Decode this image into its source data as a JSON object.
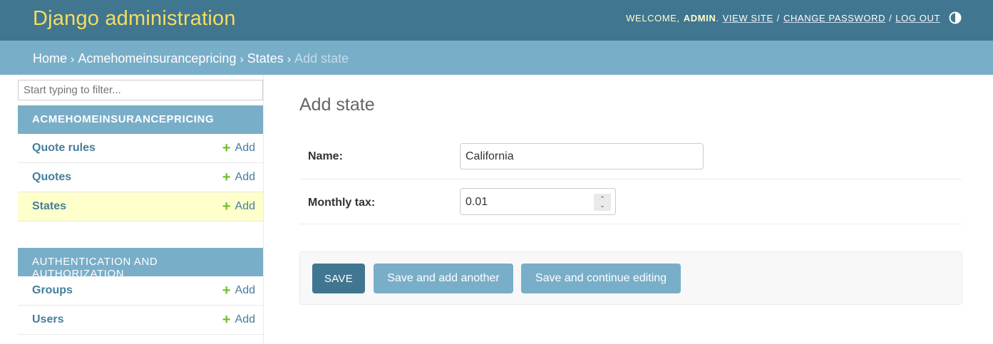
{
  "header": {
    "branding": "Django administration",
    "welcome": "WELCOME,",
    "username": "ADMIN",
    "view_site": "VIEW SITE",
    "change_password": "CHANGE PASSWORD",
    "log_out": "LOG OUT",
    "separator": "/"
  },
  "breadcrumbs": {
    "home": "Home",
    "app": "Acmehomeinsurancepricing",
    "model": "States",
    "current": "Add state",
    "separator": "›"
  },
  "sidebar": {
    "filter_placeholder": "Start typing to filter...",
    "modules": [
      {
        "caption": "ACMEHOMEINSURANCEPRICING",
        "models": [
          {
            "name": "Quote rules",
            "add": "Add"
          },
          {
            "name": "Quotes",
            "add": "Add"
          },
          {
            "name": "States",
            "add": "Add"
          }
        ]
      },
      {
        "caption": "AUTHENTICATION AND AUTHORIZATION",
        "models": [
          {
            "name": "Groups",
            "add": "Add"
          },
          {
            "name": "Users",
            "add": "Add"
          }
        ]
      }
    ],
    "add_icon": "+"
  },
  "content": {
    "title": "Add state",
    "fields": {
      "name": {
        "label": "Name:",
        "value": "California"
      },
      "monthly_tax": {
        "label": "Monthly tax:",
        "value": "0.01"
      }
    },
    "buttons": {
      "save": "Save",
      "save_add_another": "Save and add another",
      "save_continue": "Save and continue editing"
    }
  },
  "colors": {
    "header_bg": "#417690",
    "branding": "#f5dd5d",
    "breadcrumb_bg": "#79aec8",
    "selected_row": "#ffffcc",
    "add_plus": "#70bf2b"
  }
}
